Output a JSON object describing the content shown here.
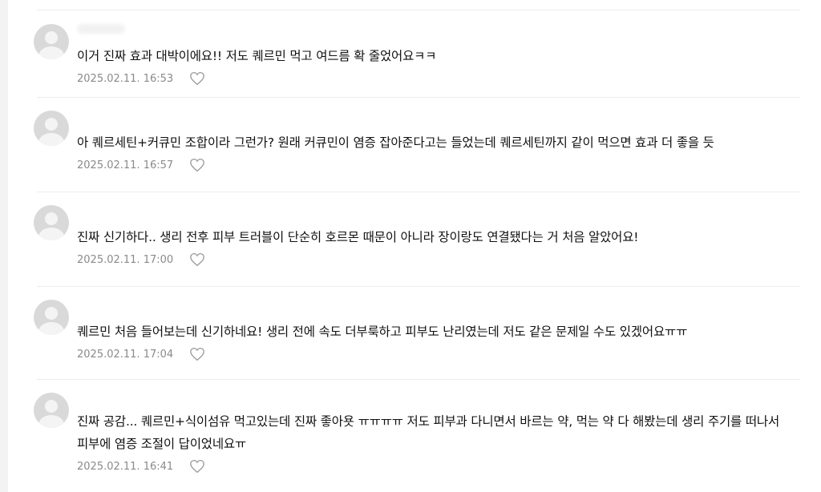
{
  "comments": [
    {
      "text": "이거 진짜 효과 대박이에요!! 저도 퀘르민 먹고 여드름 확 줄었어요ㅋㅋ",
      "date": "2025.02.11. 16:53",
      "icon": "heart-outline-icon"
    },
    {
      "text": "아 퀘르세틴+커큐민 조합이라 그런가? 원래 커큐민이 염증 잡아준다고는 들었는데 퀘르세틴까지 같이 먹으면 효과 더 좋을 듯",
      "date": "2025.02.11. 16:57",
      "icon": "heart-outline-icon"
    },
    {
      "text": "진짜 신기하다.. 생리 전후 피부 트러블이 단순히 호르몬 때문이 아니라 장이랑도 연결됐다는 거 처음 알았어요!",
      "date": "2025.02.11. 17:00",
      "icon": "heart-outline-icon"
    },
    {
      "text": "퀘르민 처음 들어보는데 신기하네요! 생리 전에 속도 더부룩하고 피부도 난리였는데 저도 같은 문제일 수도 있겠어요ㅠㅠ",
      "date": "2025.02.11. 17:04",
      "icon": "heart-outline-icon"
    },
    {
      "text": "진짜 공감... 퀘르민+식이섬유 먹고있는데 진짜 좋아욧 ㅠㅠㅠㅠ 저도 피부과 다니면서 바르는 약, 먹는 약 다 해봤는데 생리 주기를 떠나서 피부에 염증 조절이 답이었네요ㅠ",
      "date": "2025.02.11. 16:41",
      "icon": "heart-outline-icon"
    }
  ],
  "colors": {
    "text": "#111111",
    "date": "#8a8a8a",
    "divider": "#ececec",
    "avatar": "#d9d9d9"
  }
}
